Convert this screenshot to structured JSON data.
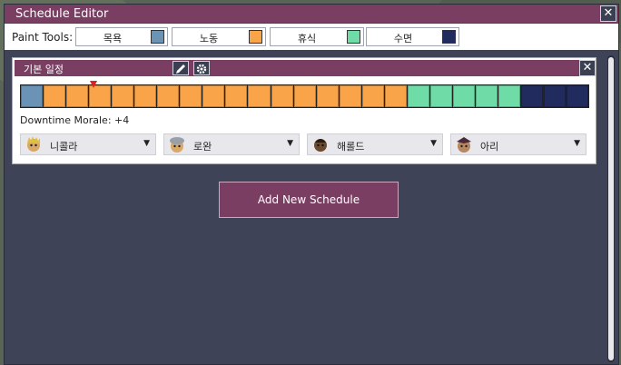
{
  "window": {
    "title": "Schedule Editor"
  },
  "toolbar": {
    "label": "Paint Tools:",
    "tools": [
      {
        "name": "목욕",
        "color": "#6a93b5"
      },
      {
        "name": "노동",
        "color": "#f9a448"
      },
      {
        "name": "휴식",
        "color": "#6fdca8"
      },
      {
        "name": "수면",
        "color": "#222b5e"
      }
    ]
  },
  "schedule": {
    "name": "기본 일정",
    "current_hour_index": 3,
    "blocks": [
      "목욕",
      "노동",
      "노동",
      "노동",
      "노동",
      "노동",
      "노동",
      "노동",
      "노동",
      "노동",
      "노동",
      "노동",
      "노동",
      "노동",
      "노동",
      "노동",
      "노동",
      "휴식",
      "휴식",
      "휴식",
      "휴식",
      "휴식",
      "수면",
      "수면",
      "수면"
    ],
    "morale": "Downtime Morale: +4",
    "dupes": [
      {
        "name": "니콜라",
        "icon": "dupe-nikola-icon"
      },
      {
        "name": "로완",
        "icon": "dupe-rowan-icon"
      },
      {
        "name": "해롤드",
        "icon": "dupe-harold-icon"
      },
      {
        "name": "아리",
        "icon": "dupe-ari-icon"
      }
    ]
  },
  "actions": {
    "add_schedule": "Add New Schedule"
  },
  "colors": {
    "accent": "#7a3e63",
    "panel": "#3e4357"
  }
}
